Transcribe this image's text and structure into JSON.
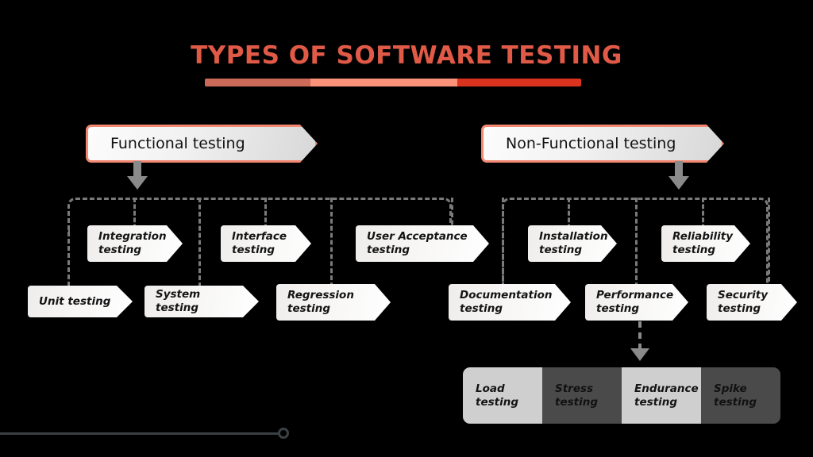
{
  "title": "TYPES OF SOFTWARE TESTING",
  "title_bar": {
    "segments": [
      {
        "color": "#CC6A5A"
      },
      {
        "color": "#FA9179"
      },
      {
        "color": "#D9321E"
      }
    ]
  },
  "branches": {
    "functional": {
      "label": "Functional testing",
      "items_top": [
        {
          "label": "Integration\ntesting"
        },
        {
          "label": "Interface\ntesting"
        },
        {
          "label": "User Acceptance\ntesting"
        }
      ],
      "items_bottom": [
        {
          "label": "Unit testing"
        },
        {
          "label": "System testing"
        },
        {
          "label": "Regression\ntesting"
        }
      ]
    },
    "nonfunctional": {
      "label": "Non-Functional testing",
      "items_top": [
        {
          "label": "Installation\ntesting"
        },
        {
          "label": "Reliability\ntesting"
        }
      ],
      "items_bottom": [
        {
          "label": "Documentation\ntesting"
        },
        {
          "label": "Performance\ntesting"
        },
        {
          "label": "Security\ntesting"
        }
      ]
    }
  },
  "performance_subtypes": [
    {
      "label": "Load\ntesting",
      "tone": "light"
    },
    {
      "label": "Stress\ntesting",
      "tone": "dark"
    },
    {
      "label": "Endurance\ntesting",
      "tone": "light"
    },
    {
      "label": "Spike\ntesting",
      "tone": "dark"
    }
  ],
  "colors": {
    "background": "#000000",
    "accent": "#E05A47",
    "banner_border": "#F28872",
    "connector": "#7A7A7A",
    "arrow": "#8A8A8A",
    "strip_light": "#CFCFCF",
    "strip_dark": "#4A4A4A"
  }
}
